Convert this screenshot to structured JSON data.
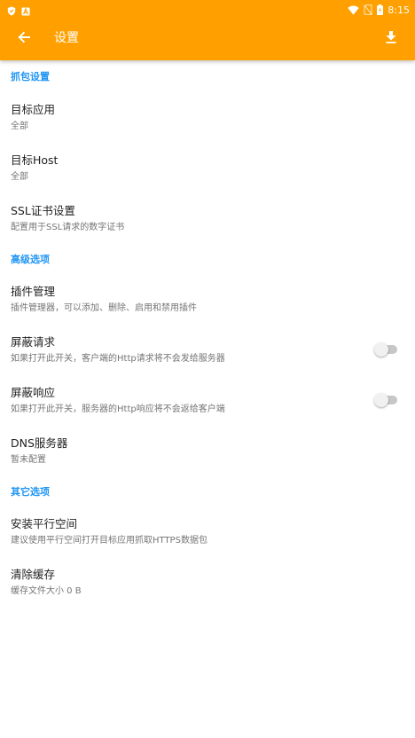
{
  "status_bar": {
    "time": "8:15",
    "left_icons": [
      "shield-icon",
      "app-a-icon"
    ],
    "right_icons": [
      "wifi-icon",
      "no-sim-icon",
      "battery-icon"
    ]
  },
  "toolbar": {
    "title": "设置",
    "back_icon": "arrow-left-icon",
    "action_icon": "download-icon",
    "background_color": "#FFA000"
  },
  "sections": [
    {
      "header": "抓包设置",
      "items": [
        {
          "title": "目标应用",
          "summary": "全部"
        },
        {
          "title": "目标Host",
          "summary": "全部"
        },
        {
          "title": "SSL证书设置",
          "summary": "配置用于SSL请求的数字证书"
        }
      ]
    },
    {
      "header": "高级选项",
      "items": [
        {
          "title": "插件管理",
          "summary": "插件管理器，可以添加、删除、启用和禁用插件"
        },
        {
          "title": "屏蔽请求",
          "summary": "如果打开此开关，客户端的Http请求将不会发给服务器",
          "switch_on": false
        },
        {
          "title": "屏蔽响应",
          "summary": "如果打开此开关，服务器的Http响应将不会返给客户端",
          "switch_on": false
        },
        {
          "title": "DNS服务器",
          "summary": "暂未配置"
        }
      ]
    },
    {
      "header": "其它选项",
      "items": [
        {
          "title": "安装平行空间",
          "summary": "建议使用平行空间打开目标应用抓取HTTPS数据包"
        },
        {
          "title": "清除缓存",
          "summary": "缓存文件大小 0 B"
        }
      ]
    }
  ],
  "colors": {
    "accent": "#2196F3",
    "primary": "#FFA000",
    "title_text": "#212121",
    "summary_text": "#757575"
  }
}
